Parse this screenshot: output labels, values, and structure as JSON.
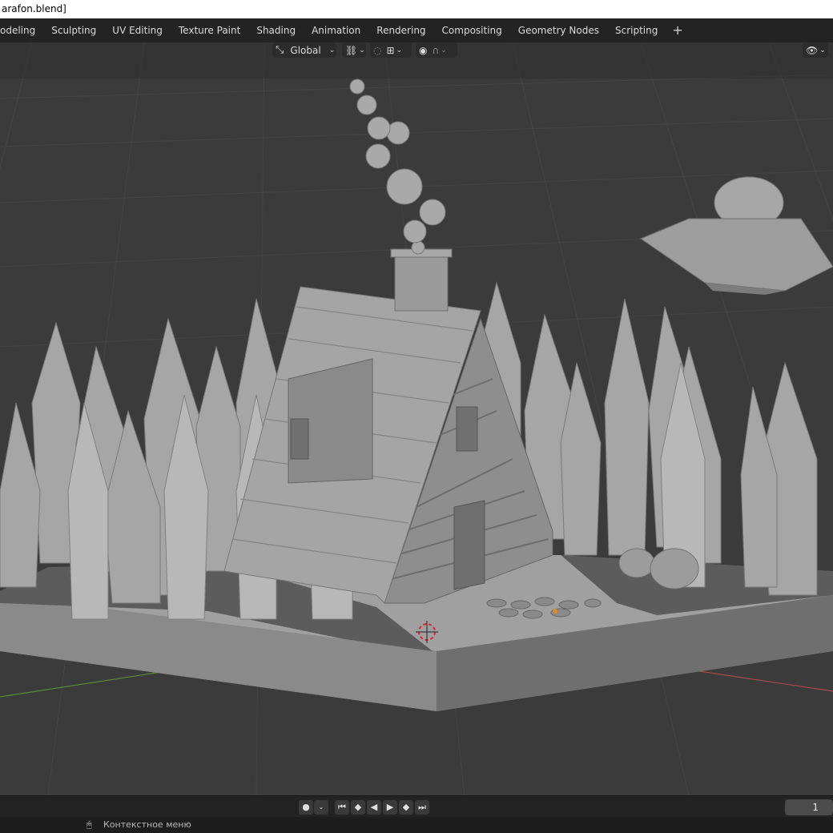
{
  "window": {
    "title": "arafon.blend]"
  },
  "workspace_tabs": [
    "odeling",
    "Sculpting",
    "UV Editing",
    "Texture Paint",
    "Shading",
    "Animation",
    "Rendering",
    "Compositing",
    "Geometry Nodes",
    "Scripting"
  ],
  "add_tab_label": "+",
  "viewport_header": {
    "transform_orientation": "Global",
    "icons": [
      "orientation-icon",
      "pivot-link-icon",
      "snap-icon",
      "snap-increment-icon",
      "proportional-edit-icon",
      "falloff-icon",
      "visibility-eye-icon"
    ]
  },
  "timeline": {
    "record_icon": "record-dot-icon",
    "controls": [
      "jump-start-icon",
      "prev-keyframe-icon",
      "play-reverse-icon",
      "play-icon",
      "next-keyframe-icon",
      "jump-end-icon"
    ],
    "current_frame": "1"
  },
  "statusbar": {
    "hint": "Контекстное меню",
    "mouse_icon": "mouse-icon"
  },
  "colors": {
    "background": "#393939",
    "header": "#232323",
    "model": "#9a9a9a",
    "axis_x": "#a94a4a",
    "axis_y": "#5a8a3a"
  }
}
